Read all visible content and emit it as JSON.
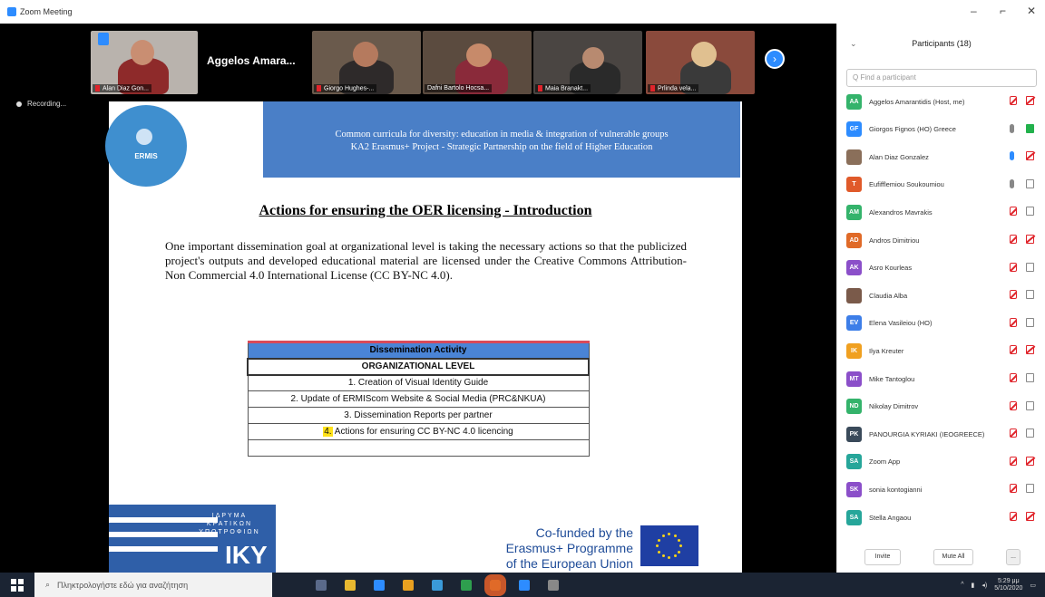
{
  "window": {
    "title": "Zoom Meeting",
    "controls": [
      "–",
      "⌐",
      "✕"
    ]
  },
  "strip": {
    "speaker_name": "Aggelos Amara...",
    "tiles": [
      {
        "name": "Alan Diaz Gon...",
        "bg": "#b9b3ad"
      },
      {
        "name": "Giorgo Hughes-...",
        "bg": "#6a5a4c"
      },
      {
        "name": "Dafni Bartolo Hocsa...",
        "bg": "#5b4b3f"
      },
      {
        "name": "Maia Branakt...",
        "bg": "#4a4542"
      },
      {
        "name": "Prlinda vela...",
        "bg": "#8a4a3c"
      }
    ],
    "next_icon": "chevron-right-icon"
  },
  "recording": {
    "label": "Recording..."
  },
  "slide": {
    "header_line1": "Common curricula for diversity: education in media & integration of vulnerable groups",
    "header_line2": "KA2 Erasmus+ Project - Strategic Partnership on the field of Higher Education",
    "logo_text": "ERMIS",
    "title": "Actions for ensuring the OER licensing - Introduction",
    "body": "One important dissemination goal at organizational level is taking the necessary actions so that the publicized project's outputs and developed educational material are licensed under the Creative Commons Attribution-Non Commercial 4.0 International License (CC BY-NC 4.0).",
    "table": {
      "header": "Dissemination Activity",
      "level": "ORGANIZATIONAL LEVEL",
      "rows": [
        "1. Creation of Visual Identity Guide",
        "2. Update of ERMIScom Website & Social Media (PRC&NKUA)",
        "3. Dissemination Reports per partner"
      ],
      "highlight_num": "4.",
      "highlight_rest": " Actions for ensuring CC BY-NC 4.0 licencing"
    },
    "iky_small": "ΙΔΡΥΜΑ ΚΡΑΤΙΚΩΝ ΥΠΟΤΡΟΦΙΩΝ",
    "iky_big": "IKY",
    "cofund_line1": "Co-funded by the",
    "cofund_line2": "Erasmus+ Programme",
    "cofund_line3": "of the European Union"
  },
  "participants": {
    "title": "Participants (18)",
    "search_placeholder": "Q Find a participant",
    "list": [
      {
        "initials": "AA",
        "color": "#34b36b",
        "name": "Aggelos Amarantidis (Host, me)",
        "mic": "muted",
        "cam": "off"
      },
      {
        "initials": "GF",
        "color": "#2d8cff",
        "name": "Giorgos Fignos (HO) Greece",
        "mic": "on",
        "cam": "on"
      },
      {
        "initials": "",
        "color": "#8a6f5a",
        "name": "Alan Diaz Gonzalez",
        "mic": "on-blue",
        "cam": "off"
      },
      {
        "initials": "T",
        "color": "#e05a2a",
        "name": "Eufifflemiou Soukoumiou",
        "mic": "on",
        "cam": "plain"
      },
      {
        "initials": "AM",
        "color": "#34b36b",
        "name": "Alexandros Mavrakis",
        "mic": "muted",
        "cam": "plain"
      },
      {
        "initials": "AD",
        "color": "#e06a28",
        "name": "Andros Dimitriou",
        "mic": "muted",
        "cam": "off"
      },
      {
        "initials": "AK",
        "color": "#8b4fc9",
        "name": "Asro Kourleas",
        "mic": "muted",
        "cam": "plain"
      },
      {
        "initials": "",
        "color": "#7a5a4a",
        "name": "Claudia Alba",
        "mic": "muted",
        "cam": "plain"
      },
      {
        "initials": "EV",
        "color": "#3d7ee8",
        "name": "Elena Vasileiou (HO)",
        "mic": "muted",
        "cam": "plain"
      },
      {
        "initials": "IK",
        "color": "#f0a020",
        "name": "Ilya Kreuter",
        "mic": "muted",
        "cam": "off"
      },
      {
        "initials": "MT",
        "color": "#8b4fc9",
        "name": "Mike Tantoglou",
        "mic": "muted",
        "cam": "plain"
      },
      {
        "initials": "ND",
        "color": "#34b36b",
        "name": "Nikolay Dimitrov",
        "mic": "muted",
        "cam": "plain"
      },
      {
        "initials": "PK",
        "color": "#3a4a5a",
        "name": "PANOURGIA KYRIAKI (IEOGREECE)",
        "mic": "muted",
        "cam": "plain"
      },
      {
        "initials": "SA",
        "color": "#26a69a",
        "name": "Zoom App",
        "mic": "muted",
        "cam": "off"
      },
      {
        "initials": "SK",
        "color": "#8b4fc9",
        "name": "sonia kontogianni",
        "mic": "muted",
        "cam": "plain"
      },
      {
        "initials": "SA",
        "color": "#26a69a",
        "name": "Stella Angaou",
        "mic": "muted",
        "cam": "off"
      }
    ],
    "invite_label": "Invite",
    "mute_all_label": "Mute All",
    "more_label": "..."
  },
  "taskbar": {
    "search_placeholder": "Πληκτρολογήστε εδώ για αναζήτηση",
    "time": "5:29 μμ",
    "date": "5/10/2020",
    "apps": [
      "#5a6a8a",
      "#e8b830",
      "#2d8cff",
      "#e8a020",
      "#3a9ad9",
      "#2e9e4e",
      "#e06a28",
      "#2d8cff",
      "#888"
    ]
  }
}
